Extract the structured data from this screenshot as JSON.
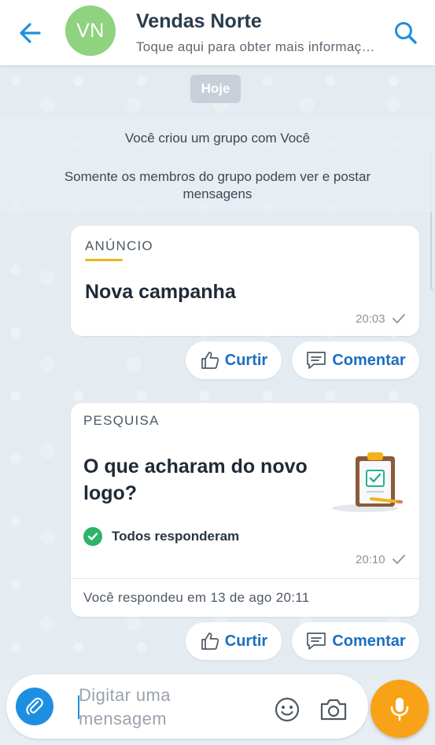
{
  "header": {
    "avatar_initials": "VN",
    "title": "Vendas Norte",
    "subtitle": "Toque aqui para obter mais informações"
  },
  "chat": {
    "date_chip": "Hoje",
    "system_messages": [
      "Você criou um grupo com Você",
      "Somente os membros do grupo podem ver e postar mensagens"
    ],
    "announcement": {
      "label": "ANÚNCIO",
      "heading": "Nova campanha",
      "time": "20:03"
    },
    "survey": {
      "label": "PESQUISA",
      "question": "O que acharam do novo logo?",
      "status": "Todos responderam",
      "time": "20:10",
      "response_note": "Você respondeu em 13 de ago 20:11"
    },
    "actions": {
      "like_label": "Curtir",
      "comment_label": "Comentar"
    }
  },
  "composer": {
    "placeholder": "Digitar uma mensagem"
  },
  "colors": {
    "accent_blue": "#1d8fe0",
    "action_blue": "#1b6fc0",
    "avatar_green": "#8fd27f",
    "mic_orange": "#f8a317",
    "status_green": "#2db36a",
    "label_underline": "#f2b21b"
  },
  "icons": {
    "back": "arrow-left-icon",
    "search": "search-icon",
    "like": "thumbs-up-icon",
    "comment": "comment-icon",
    "clipboard": "clipboard-check-icon",
    "attach": "paperclip-icon",
    "emoji": "smiley-icon",
    "camera": "camera-icon",
    "mic": "microphone-icon"
  }
}
